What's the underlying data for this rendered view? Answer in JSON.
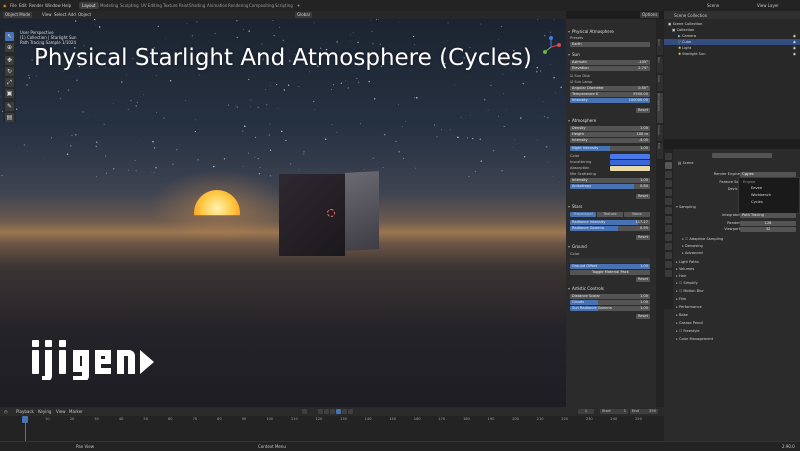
{
  "menu": [
    "File",
    "Edit",
    "Render",
    "Window",
    "Help"
  ],
  "workspaces": [
    "Layout",
    "Modeling",
    "Sculpting",
    "UV Editing",
    "Texture Paint",
    "Shading",
    "Animation",
    "Rendering",
    "Compositing",
    "Scripting"
  ],
  "active_workspace": "Layout",
  "topright": {
    "scene": "Scene",
    "view_layer": "View Layer"
  },
  "viewport_header": {
    "mode": "Object Mode",
    "view": "View",
    "select": "Select",
    "add": "Add",
    "object": "Object",
    "orientation": "Global",
    "options": "Options"
  },
  "viewport_info": [
    "User Perspective",
    "(1) Collection | Starlight Sun",
    "Path Tracing Sample 1/1024"
  ],
  "overlay_title": "Physical Starlight And Atmosphere (Cycles)",
  "logo_text": "ijigen",
  "tools": [
    "tweak",
    "cursor",
    "move",
    "rotate",
    "scale",
    "transform",
    "annotate",
    "measure"
  ],
  "npanel": {
    "header": "Physical Atmosphere",
    "presets_label": "Presets",
    "preset_value": "Earth",
    "sun": {
      "title": "Sun",
      "azimuth_label": "Azimuth",
      "azimuth": "-105°",
      "elevation_label": "Elevation",
      "elevation": "2.74°",
      "sun_disk": "Sun Disk",
      "sun_lamp": "Sun Lamp",
      "angular_label": "Angular Diameter",
      "angular": "0.50°",
      "temp_label": "Temperature K",
      "temp": "5500.00",
      "intensity_label": "Intensity",
      "intensity": "100000.00",
      "reset": "Reset"
    },
    "atmosphere": {
      "title": "Atmosphere",
      "density_label": "Density",
      "density": "1.00",
      "height_label": "Height",
      "height": "100 m",
      "intensity_label": "Intensity",
      "intensity": "-4.00",
      "night_label": "Night Intensity",
      "night": "1.00",
      "color_label": "Color",
      "inscatter_label": "Inscattering",
      "absorption_label": "Absorption",
      "mie_label": "Mie Scattering",
      "mie_intensity_label": "Intensity",
      "mie_intensity": "1.00",
      "anisotropy_label": "Anisotropy",
      "anisotropy": "0.80",
      "reset": "Reset",
      "colors": {
        "color": "#4a78e8",
        "inscatter": "#3a66d8",
        "absorption": "#e8d9a8"
      }
    },
    "stars": {
      "title": "Stars",
      "tabs": [
        "Procedural",
        "Texture",
        "None"
      ],
      "active_tab": "Procedural",
      "radiance_label": "Radiance Intensity",
      "radiance": "117.27",
      "gamma_label": "Radiance Gamma",
      "gamma": "0.95",
      "reset": "Reset"
    },
    "ground": {
      "title": "Ground",
      "color_label": "Color",
      "offset_label": "Ground Offset",
      "offset": "1.00",
      "toggle": "Toggle Material Pack",
      "reset": "Reset"
    },
    "artistic": {
      "title": "Artistic Controls",
      "dist_label": "Distance Scalar",
      "dist": "1.00",
      "clouds_label": "Clouds",
      "clouds": "1.00",
      "sun_rad_label": "Sun Radiance Gamma",
      "sun_rad": "1.00",
      "reset": "Reset"
    },
    "tabs": [
      "Item",
      "Tool",
      "View",
      "Atmosphere",
      "Create",
      "Edit"
    ]
  },
  "outliner": {
    "header": "Scene Collection",
    "rows": [
      {
        "name": "Scene Collection",
        "indent": 0,
        "selected": false
      },
      {
        "name": "Collection",
        "indent": 1,
        "selected": false
      },
      {
        "name": "Camera",
        "indent": 2,
        "selected": false
      },
      {
        "name": "Cube",
        "indent": 2,
        "selected": true
      },
      {
        "name": "Light",
        "indent": 2,
        "selected": false
      },
      {
        "name": "Starlight Sun",
        "indent": 2,
        "selected": false
      }
    ]
  },
  "properties": {
    "scene": "Scene",
    "render_engine_label": "Render Engine",
    "render_engine": "Cycles",
    "feature_set_label": "Feature Set",
    "device_label": "Device",
    "engine_options_header": "Engine",
    "engine_options": [
      "Eevee",
      "Workbench",
      "Cycles"
    ],
    "sampling": "Sampling",
    "integrator_label": "Integrator",
    "integrator": "Path Tracing",
    "render_label": "Render",
    "render_samples": "128",
    "viewport_label": "Viewport",
    "viewport_samples": "32",
    "adaptive": "Adaptive Sampling",
    "denoising": "Denoising",
    "advanced": "Advanced",
    "sections": [
      "Light Paths",
      "Volumes",
      "Hair",
      "Simplify",
      "Motion Blur",
      "Film",
      "Performance",
      "Bake",
      "Grease Pencil",
      "Freestyle",
      "Color Management"
    ]
  },
  "timeline": {
    "playback": "Playback",
    "keying": "Keying",
    "view": "View",
    "marker": "Marker",
    "current_frame": "1",
    "start_label": "Start",
    "start": "1",
    "end_label": "End",
    "end": "250",
    "ticks": [
      "1",
      "10",
      "20",
      "30",
      "40",
      "50",
      "60",
      "70",
      "80",
      "90",
      "100",
      "110",
      "120",
      "130",
      "140",
      "150",
      "160",
      "170",
      "180",
      "190",
      "200",
      "210",
      "220",
      "230",
      "240",
      "250"
    ]
  },
  "status": {
    "left": "Pan View",
    "mid": "Context Menu",
    "version": "2.90.0"
  }
}
